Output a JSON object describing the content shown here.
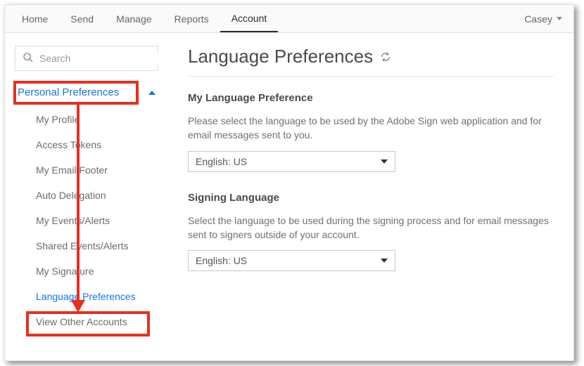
{
  "topnav": {
    "tabs": [
      "Home",
      "Send",
      "Manage",
      "Reports",
      "Account"
    ],
    "active_index": 4,
    "user_name": "Casey"
  },
  "sidebar": {
    "search_placeholder": "Search",
    "section_label": "Personal Preferences",
    "section_expanded": true,
    "items": [
      "My Profile",
      "Access Tokens",
      "My Email Footer",
      "Auto Delegation",
      "My Events/Alerts",
      "Shared Events/Alerts",
      "My Signature",
      "Language Preferences",
      "View Other Accounts"
    ],
    "active_item_index": 7
  },
  "main": {
    "page_title": "Language Preferences",
    "sections": [
      {
        "heading": "My Language Preference",
        "description": "Please select the language to be used by the Adobe Sign web application and for email messages sent to you.",
        "selected_value": "English: US"
      },
      {
        "heading": "Signing Language",
        "description": "Select the language to be used during the signing process and for email messages sent to signers outside of your account.",
        "selected_value": "English: US"
      }
    ]
  }
}
